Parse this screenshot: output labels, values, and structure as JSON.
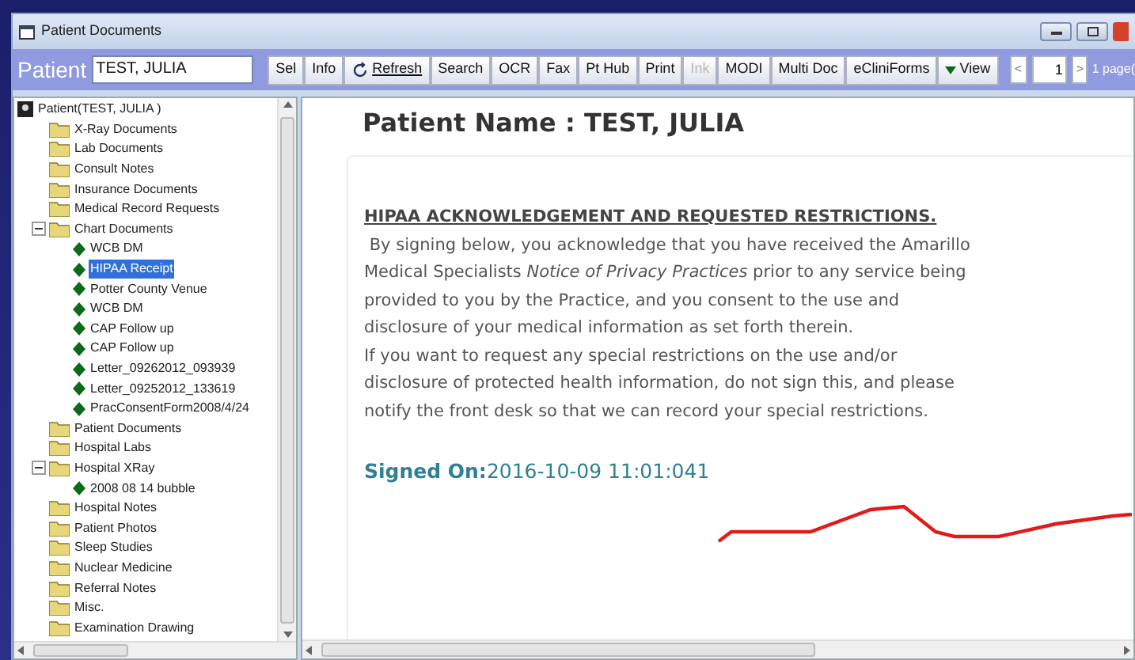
{
  "window": {
    "title": "Patient Documents"
  },
  "toolbar": {
    "patient_label": "Patient",
    "patient_field": "TEST, JULIA",
    "buttons": [
      {
        "label": "Sel",
        "kind": "text",
        "disabled": false
      },
      {
        "label": "Info",
        "kind": "text",
        "disabled": false
      },
      {
        "label": "Refresh",
        "kind": "refresh",
        "disabled": false
      },
      {
        "label": "Search",
        "kind": "text",
        "disabled": false
      },
      {
        "label": "OCR",
        "kind": "text",
        "disabled": false
      },
      {
        "label": "Fax",
        "kind": "text",
        "disabled": false
      },
      {
        "label": "Pt Hub",
        "kind": "text",
        "disabled": false
      },
      {
        "label": "Print",
        "kind": "text",
        "disabled": false
      },
      {
        "label": "Ink",
        "kind": "text",
        "disabled": true
      },
      {
        "label": "MODI",
        "kind": "text",
        "disabled": false
      },
      {
        "label": "Multi Doc",
        "kind": "text",
        "disabled": false
      },
      {
        "label": "eCliniForms",
        "kind": "text",
        "disabled": false
      },
      {
        "label": "View",
        "kind": "dropdown",
        "disabled": false
      }
    ],
    "pager": {
      "prev": "<",
      "page": "1",
      "next": ">",
      "total": "1 page("
    }
  },
  "tree": {
    "label": "Patient(TEST, JULIA )",
    "children": [
      {
        "label": "X-Ray Documents",
        "kind": "folder",
        "selected": false
      },
      {
        "label": "Lab Documents",
        "kind": "folder",
        "selected": false
      },
      {
        "label": "Consult Notes",
        "kind": "folder",
        "selected": false
      },
      {
        "label": "Insurance Documents",
        "kind": "folder",
        "selected": false
      },
      {
        "label": "Medical Record Requests",
        "kind": "folder",
        "selected": false
      },
      {
        "label": "Chart Documents",
        "kind": "folder",
        "selected": false,
        "expanded": true,
        "children": [
          {
            "label": "WCB DM",
            "kind": "document",
            "selected": false
          },
          {
            "label": "HIPAA Receipt",
            "kind": "document",
            "selected": true
          },
          {
            "label": "Potter County Venue",
            "kind": "document",
            "selected": false
          },
          {
            "label": "WCB DM",
            "kind": "document",
            "selected": false
          },
          {
            "label": "CAP Follow up",
            "kind": "document",
            "selected": false
          },
          {
            "label": "CAP Follow up",
            "kind": "document",
            "selected": false
          },
          {
            "label": "Letter_09262012_093939",
            "kind": "document",
            "selected": false
          },
          {
            "label": "Letter_09252012_133619",
            "kind": "document",
            "selected": false
          },
          {
            "label": "PracConsentForm2008/4/24",
            "kind": "document",
            "selected": false
          }
        ]
      },
      {
        "label": "Patient Documents",
        "kind": "folder",
        "selected": false
      },
      {
        "label": "Hospital Labs",
        "kind": "folder",
        "selected": false
      },
      {
        "label": "Hospital XRay",
        "kind": "folder",
        "selected": false,
        "expanded": true,
        "children": [
          {
            "label": "2008 08 14 bubble",
            "kind": "document",
            "selected": false
          }
        ]
      },
      {
        "label": "Hospital Notes",
        "kind": "folder",
        "selected": false
      },
      {
        "label": "Patient Photos",
        "kind": "folder",
        "selected": false
      },
      {
        "label": "Sleep Studies",
        "kind": "folder",
        "selected": false
      },
      {
        "label": "Nuclear Medicine",
        "kind": "folder",
        "selected": false
      },
      {
        "label": "Referral Notes",
        "kind": "folder",
        "selected": false
      },
      {
        "label": "Misc.",
        "kind": "folder",
        "selected": false
      },
      {
        "label": "Examination Drawing",
        "kind": "folder",
        "selected": false
      }
    ]
  },
  "document": {
    "patient_name": "Patient Name : TEST, JULIA",
    "heading": "HIPAA ACKNOWLEDGEMENT AND REQUESTED RESTRICTIONS.",
    "paragraphs": [
      " By signing below, you acknowledge that you have received the Amarillo Medical Specialists *Notice of Privacy Practices* prior to any service being provided to you by the Practice, and you consent to the use and disclosure of your medical information as set forth therein.",
      "If you want to request any special restrictions on the use and/or disclosure of protected health information, do not sign this, and please notify the front desk so that we can record your special restrictions."
    ],
    "signed": "**Signed On:**2016-10-09 11:01:041"
  }
}
